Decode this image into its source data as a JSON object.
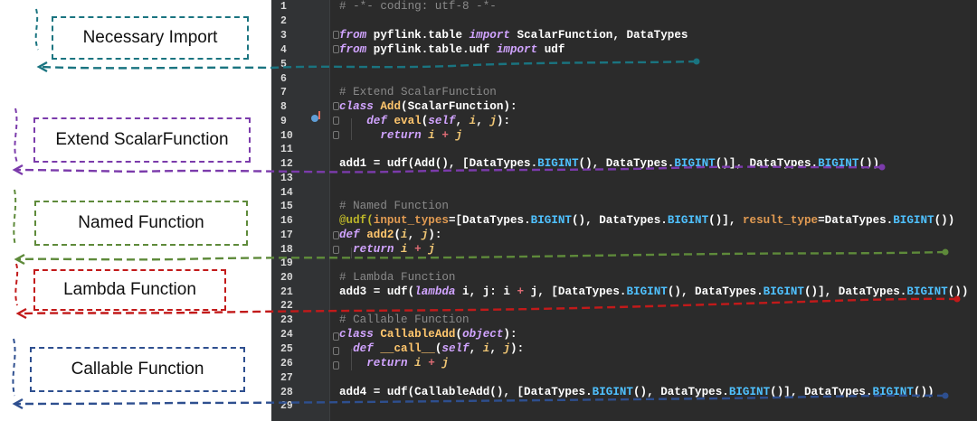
{
  "labels": {
    "import": "Necessary Import",
    "extend": "Extend ScalarFunction",
    "named": "Named Function",
    "lambda": "Lambda Function",
    "callable": "Callable Function"
  },
  "colors": {
    "import": "#1a7480",
    "extend": "#7b3bab",
    "named": "#5e8a3a",
    "lambda": "#c21a1a",
    "callable": "#2e4f8f",
    "editor_bg": "#2b2b2b"
  },
  "line_numbers": [
    "1",
    "2",
    "3",
    "4",
    "5",
    "6",
    "7",
    "8",
    "9",
    "10",
    "11",
    "12",
    "13",
    "14",
    "15",
    "16",
    "17",
    "18",
    "19",
    "20",
    "21",
    "22",
    "23",
    "24",
    "25",
    "26",
    "27",
    "28",
    "29"
  ],
  "code": {
    "l1": "# -*- coding: utf-8 -*-",
    "l3_a": "from",
    "l3_b": " pyflink.table ",
    "l3_c": "import",
    "l3_d": " ScalarFunction, DataTypes",
    "l4_a": "from",
    "l4_b": " pyflink.table.udf ",
    "l4_c": "import",
    "l4_d": " udf",
    "l7": "# Extend ScalarFunction",
    "l8_a": "class",
    "l8_b": " Add",
    "l8_c": "(ScalarFunction):",
    "l9_a": "def",
    "l9_b": " eval",
    "l9_c": "(",
    "l9_d": "self",
    "l9_e": ", ",
    "l9_f": "i",
    "l9_g": ", ",
    "l9_h": "j",
    "l9_i": "):",
    "l10_a": "return",
    "l10_b": " i ",
    "l10_c": "+",
    "l10_d": " j",
    "l12_a": "add1 = udf(Add(), [DataTypes.",
    "l12_b": "BIGINT",
    "l12_c": "(), DataTypes.",
    "l12_d": "BIGINT",
    "l12_e": "()], DataTypes.",
    "l12_f": "BIGINT",
    "l12_g": "())",
    "l15": "# Named Function",
    "l16_a": "@udf(",
    "l16_b": "input_types",
    "l16_c": "=[DataTypes.",
    "l16_d": "BIGINT",
    "l16_e": "(), DataTypes.",
    "l16_f": "BIGINT",
    "l16_g": "()], ",
    "l16_h": "result_type",
    "l16_i": "=DataTypes.",
    "l16_j": "BIGINT",
    "l16_k": "())",
    "l17_a": "def",
    "l17_b": " add2",
    "l17_c": "(",
    "l17_d": "i",
    "l17_e": ", ",
    "l17_f": "j",
    "l17_g": "):",
    "l18_a": "return",
    "l18_b": " i ",
    "l18_c": "+",
    "l18_d": " j",
    "l20": "# Lambda Function",
    "l21_a": "add3 = udf(",
    "l21_b": "lambda",
    "l21_c": " i, j: i ",
    "l21_d": "+",
    "l21_e": " j, [DataTypes.",
    "l21_f": "BIGINT",
    "l21_g": "(), DataTypes.",
    "l21_h": "BIGINT",
    "l21_i": "()], DataTypes.",
    "l21_j": "BIGINT",
    "l21_k": "())",
    "l23": "# Callable Function",
    "l24_a": "class",
    "l24_b": " CallableAdd",
    "l24_c": "(",
    "l24_d": "object",
    "l24_e": "):",
    "l25_a": "def",
    "l25_b": " __call__",
    "l25_c": "(",
    "l25_d": "self",
    "l25_e": ", ",
    "l25_f": "i",
    "l25_g": ", ",
    "l25_h": "j",
    "l25_i": "):",
    "l26_a": "return",
    "l26_b": " i ",
    "l26_c": "+",
    "l26_d": " j",
    "l28_a": "add4 = udf(CallableAdd(), [DataTypes.",
    "l28_b": "BIGINT",
    "l28_c": "(), DataTypes.",
    "l28_d": "BIGINT",
    "l28_e": "()], DataTypes.",
    "l28_f": "BIGINT",
    "l28_g": "())"
  }
}
